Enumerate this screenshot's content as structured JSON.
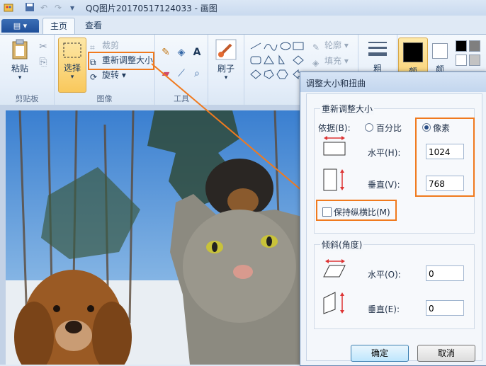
{
  "window": {
    "title": "QQ图片20170517124033 - 画图"
  },
  "tabs": {
    "file_menu": "▤ ▾",
    "home": "主页",
    "view": "查看"
  },
  "clipboard": {
    "paste": "粘贴",
    "group": "剪贴板"
  },
  "image": {
    "select": "选择",
    "crop": "裁剪",
    "resize": "重新调整大小",
    "rotate": "旋转",
    "group": "图像"
  },
  "tools": {
    "group": "工具",
    "text_tool": "A"
  },
  "brush": {
    "label": "刷子"
  },
  "shapes": {
    "outline": "轮廓",
    "fill": "填充",
    "group": "形"
  },
  "colors": {
    "size": "粗",
    "color1": "颜",
    "color2": "颜",
    "accent": "#f07a1e",
    "palette_black": "#000000",
    "palette_gray": "#7f7f7f"
  },
  "dialog": {
    "title": "调整大小和扭曲",
    "resize_section": "重新调整大小",
    "by_label": "依据(B):",
    "percent_option": "百分比",
    "pixels_option": "像素",
    "horizontal_label": "水平(H):",
    "horizontal_value": "1024",
    "vertical_label": "垂直(V):",
    "vertical_value": "768",
    "keep_ratio": "保持纵横比(M)",
    "skew_section": "倾斜(角度)",
    "skew_h_label": "水平(O):",
    "skew_h_value": "0",
    "skew_v_label": "垂直(E):",
    "skew_v_value": "0",
    "ok": "确定",
    "cancel": "取消"
  }
}
